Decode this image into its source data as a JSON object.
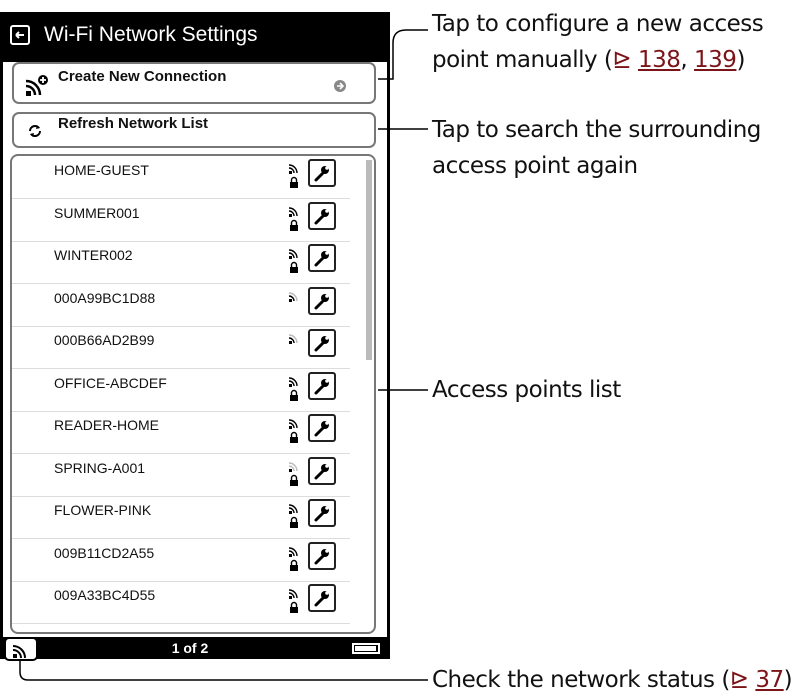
{
  "header": {
    "title": "Wi-Fi Network Settings"
  },
  "actions": {
    "create_label": "Create New Connection",
    "refresh_label": "Refresh Network List"
  },
  "networks": [
    {
      "name": "HOME-GUEST",
      "signal": 3,
      "locked": true
    },
    {
      "name": "SUMMER001",
      "signal": 3,
      "locked": true
    },
    {
      "name": "WINTER002",
      "signal": 3,
      "locked": true
    },
    {
      "name": "000A99BC1D88",
      "signal": 2,
      "locked": false
    },
    {
      "name": "000B66AD2B99",
      "signal": 2,
      "locked": false
    },
    {
      "name": "OFFICE-ABCDEF",
      "signal": 3,
      "locked": true
    },
    {
      "name": "READER-HOME",
      "signal": 3,
      "locked": true
    },
    {
      "name": "SPRING-A001",
      "signal": 1,
      "locked": true
    },
    {
      "name": "FLOWER-PINK",
      "signal": 3,
      "locked": true
    },
    {
      "name": "009B11CD2A55",
      "signal": 3,
      "locked": true
    },
    {
      "name": "009A33BC4D55",
      "signal": 3,
      "locked": true
    }
  ],
  "footer": {
    "page_indicator": "1 of 2"
  },
  "callouts": {
    "create_line1": "Tap to configure a new access",
    "create_line2_prefix": "point manually (",
    "create_ref1": "138",
    "create_sep": ", ",
    "create_ref2": "139",
    "create_close": ")",
    "refresh_line1": "Tap to search the surrounding",
    "refresh_line2": "access point again",
    "list_label": "Access points list",
    "status_prefix": "Check the network status (",
    "status_ref": "37",
    "status_close": ")",
    "ref_symbol": "⊵"
  },
  "colors": {
    "ref_link": "#7b1418",
    "titlebar_bg": "#000000"
  }
}
